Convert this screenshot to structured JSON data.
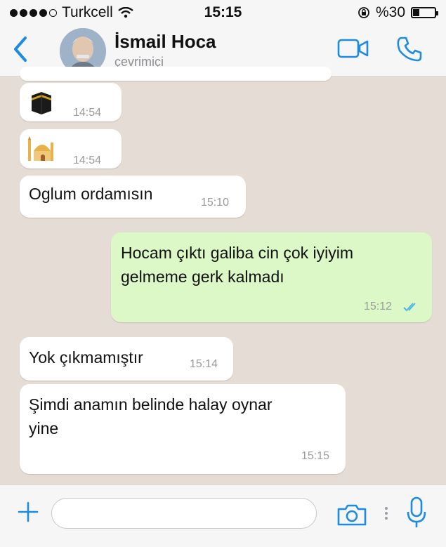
{
  "status_bar": {
    "carrier": "Turkcell",
    "time": "15:15",
    "battery": "%30",
    "battery_level": 0.3
  },
  "header": {
    "contact_name": "İsmail Hoca",
    "presence": "çevrimiçi",
    "icons": [
      "back-chevron-icon",
      "video-call-icon",
      "phone-call-icon"
    ]
  },
  "messages": [
    {
      "direction": "in",
      "kind": "emoji",
      "emoji": "kaaba",
      "time": "14:54"
    },
    {
      "direction": "in",
      "kind": "emoji",
      "emoji": "mosque",
      "time": "14:54"
    },
    {
      "direction": "in",
      "kind": "text",
      "text": "Oglum ordamısın",
      "time": "15:10"
    },
    {
      "direction": "out",
      "kind": "text",
      "lines": [
        "Hocam çıktı galiba cin çok iyiyim",
        "gelmeme gerk kalmadı"
      ],
      "time": "15:12",
      "status": "read"
    },
    {
      "direction": "in",
      "kind": "text",
      "text": "Yok çıkmamıştır",
      "time": "15:14"
    },
    {
      "direction": "in",
      "kind": "text",
      "lines": [
        "Şimdi anamın belinde halay oynar",
        "yine"
      ],
      "time": "15:15"
    }
  ],
  "input_bar": {
    "icons": [
      "plus-icon",
      "camera-icon",
      "microphone-icon"
    ],
    "message_value": ""
  },
  "colors": {
    "accent": "#1d8ce0",
    "outgoing_bubble": "#dcf8c6",
    "incoming_bubble": "#ffffff",
    "chat_background": "#e5ddd5",
    "read_ticks": "#4fb6ec"
  }
}
